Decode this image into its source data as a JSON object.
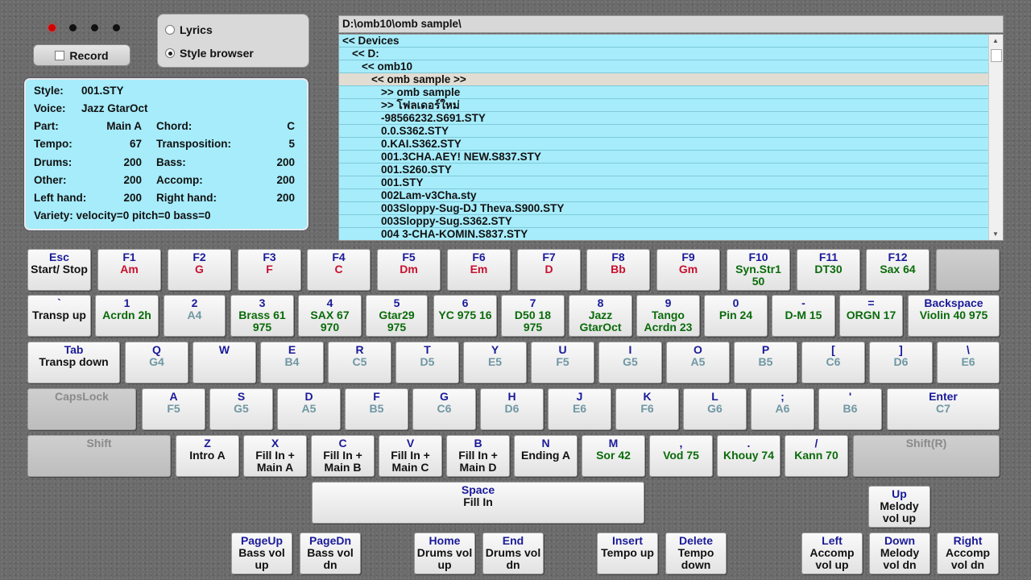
{
  "leds": [
    true,
    false,
    false,
    false
  ],
  "record": {
    "label": "Record"
  },
  "mode": {
    "lyrics": "Lyrics",
    "style_browser": "Style browser",
    "selected": "style_browser"
  },
  "info": {
    "style_label": "Style:",
    "style_value": "001.STY",
    "voice_label": "Voice:",
    "voice_value": "Jazz GtarOct",
    "part_label": "Part:",
    "part_value": "Main A",
    "chord_label": "Chord:",
    "chord_value": "C",
    "tempo_label": "Tempo:",
    "tempo_value": "67",
    "transposition_label": "Transposition:",
    "transposition_value": "5",
    "drums_label": "Drums:",
    "drums_value": "200",
    "bass_label": "Bass:",
    "bass_value": "200",
    "other_label": "Other:",
    "other_value": "200",
    "accomp_label": "Accomp:",
    "accomp_value": "200",
    "lefthand_label": "Left hand:",
    "lefthand_value": "200",
    "righthand_label": "Right hand:",
    "righthand_value": "200",
    "variety": "Variety: velocity=0 pitch=0 bass=0"
  },
  "browser": {
    "path": "D:\\omb10\\omb sample\\",
    "items": [
      "<< Devices",
      "<< D:",
      "<< omb10",
      "<< omb sample >>",
      ">> omb sample",
      ">> โฟลเดอร์ใหม่",
      "-98566232.S691.STY",
      "0.0.S362.STY",
      "0.KAI.S362.STY",
      "001.3CHA.AEY! NEW.S837.STY",
      "001.S260.STY",
      "001.STY",
      "002Lam-v3Cha.sty",
      "003Sloppy-Sug-DJ Theva.S900.STY",
      "003Sloppy-Sug.S362.STY",
      "004 3-CHA-KOMIN.S837.STY"
    ],
    "selected_index": 3
  },
  "keyboard": {
    "row1": [
      {
        "k": "Esc",
        "t": "Start/ Stop",
        "c": "black"
      },
      {
        "k": "F1",
        "t": "Am",
        "c": "red"
      },
      {
        "k": "F2",
        "t": "G",
        "c": "red"
      },
      {
        "k": "F3",
        "t": "F",
        "c": "red"
      },
      {
        "k": "F4",
        "t": "C",
        "c": "red"
      },
      {
        "k": "F5",
        "t": "Dm",
        "c": "red"
      },
      {
        "k": "F6",
        "t": "Em",
        "c": "red"
      },
      {
        "k": "F7",
        "t": "D",
        "c": "red"
      },
      {
        "k": "F8",
        "t": "Bb",
        "c": "red"
      },
      {
        "k": "F9",
        "t": "Gm",
        "c": "red"
      },
      {
        "k": "F10",
        "t": "Syn.Str1\n50",
        "c": "green"
      },
      {
        "k": "F11",
        "t": "DT30",
        "c": "green"
      },
      {
        "k": "F12",
        "t": "Sax 64",
        "c": "green"
      },
      {
        "k": "",
        "t": "",
        "c": "black",
        "dis": true
      }
    ],
    "row2": [
      {
        "k": "`",
        "t": "Transp up",
        "c": "black"
      },
      {
        "k": "1",
        "t": "Acrdn 2h",
        "c": "green"
      },
      {
        "k": "2",
        "t": "A4",
        "c": "teal"
      },
      {
        "k": "3",
        "t": "Brass 61\n975",
        "c": "green"
      },
      {
        "k": "4",
        "t": "SAX 67\n970",
        "c": "green"
      },
      {
        "k": "5",
        "t": "Gtar29\n975",
        "c": "green"
      },
      {
        "k": "6",
        "t": "YC 975 16",
        "c": "green"
      },
      {
        "k": "7",
        "t": "D50 18\n975",
        "c": "green"
      },
      {
        "k": "8",
        "t": "Jazz\nGtarOct",
        "c": "green"
      },
      {
        "k": "9",
        "t": "Tango\nAcrdn 23",
        "c": "green"
      },
      {
        "k": "0",
        "t": "Pin 24",
        "c": "green"
      },
      {
        "k": "-",
        "t": "D-M 15",
        "c": "green"
      },
      {
        "k": "=",
        "t": "ORGN 17",
        "c": "green"
      },
      {
        "k": "Backspace",
        "t": "Violin 40 975",
        "c": "green"
      }
    ],
    "row3": [
      {
        "k": "Tab",
        "t": "Transp down",
        "c": "black"
      },
      {
        "k": "Q",
        "t": "G4",
        "c": "teal"
      },
      {
        "k": "W",
        "t": "",
        "c": "teal"
      },
      {
        "k": "E",
        "t": "B4",
        "c": "teal"
      },
      {
        "k": "R",
        "t": "C5",
        "c": "teal"
      },
      {
        "k": "T",
        "t": "D5",
        "c": "teal"
      },
      {
        "k": "Y",
        "t": "E5",
        "c": "teal"
      },
      {
        "k": "U",
        "t": "F5",
        "c": "teal"
      },
      {
        "k": "I",
        "t": "G5",
        "c": "teal"
      },
      {
        "k": "O",
        "t": "A5",
        "c": "teal"
      },
      {
        "k": "P",
        "t": "B5",
        "c": "teal"
      },
      {
        "k": "[",
        "t": "C6",
        "c": "teal"
      },
      {
        "k": "]",
        "t": "D6",
        "c": "teal"
      },
      {
        "k": "\\",
        "t": "E6",
        "c": "teal"
      }
    ],
    "row4": [
      {
        "k": "CapsLock",
        "t": "",
        "c": "black",
        "dis": true
      },
      {
        "k": "A",
        "t": "F5",
        "c": "teal"
      },
      {
        "k": "S",
        "t": "G5",
        "c": "teal"
      },
      {
        "k": "D",
        "t": "A5",
        "c": "teal"
      },
      {
        "k": "F",
        "t": "B5",
        "c": "teal"
      },
      {
        "k": "G",
        "t": "C6",
        "c": "teal"
      },
      {
        "k": "H",
        "t": "D6",
        "c": "teal"
      },
      {
        "k": "J",
        "t": "E6",
        "c": "teal"
      },
      {
        "k": "K",
        "t": "F6",
        "c": "teal"
      },
      {
        "k": "L",
        "t": "G6",
        "c": "teal"
      },
      {
        "k": ";",
        "t": "A6",
        "c": "teal"
      },
      {
        "k": "'",
        "t": "B6",
        "c": "teal"
      },
      {
        "k": "Enter",
        "t": "C7",
        "c": "teal"
      }
    ],
    "row5": [
      {
        "k": "Shift",
        "t": "",
        "c": "black",
        "dis": true
      },
      {
        "k": "Z",
        "t": "Intro A",
        "c": "black"
      },
      {
        "k": "X",
        "t": "Fill In +\nMain A",
        "c": "black"
      },
      {
        "k": "C",
        "t": "Fill In +\nMain B",
        "c": "black"
      },
      {
        "k": "V",
        "t": "Fill In +\nMain C",
        "c": "black"
      },
      {
        "k": "B",
        "t": "Fill In +\nMain D",
        "c": "black"
      },
      {
        "k": "N",
        "t": "Ending A",
        "c": "black"
      },
      {
        "k": "M",
        "t": "Sor 42",
        "c": "green"
      },
      {
        "k": ",",
        "t": "Vod 75",
        "c": "green"
      },
      {
        "k": ".",
        "t": "Khouy 74",
        "c": "green"
      },
      {
        "k": "/",
        "t": "Kann 70",
        "c": "green"
      },
      {
        "k": "Shift(R)",
        "t": "",
        "c": "black",
        "dis": true
      }
    ],
    "space": {
      "k": "Space",
      "t": "Fill In",
      "c": "black"
    },
    "up": {
      "k": "Up",
      "t": "Melody\nvol up",
      "c": "black"
    },
    "row7": [
      {
        "k": "PageUp",
        "t": "Bass vol\nup",
        "c": "black"
      },
      {
        "k": "PageDn",
        "t": "Bass vol\ndn",
        "c": "black"
      },
      {
        "k": "Home",
        "t": "Drums vol\nup",
        "c": "black"
      },
      {
        "k": "End",
        "t": "Drums vol\ndn",
        "c": "black"
      },
      {
        "k": "Insert",
        "t": "Tempo up",
        "c": "black"
      },
      {
        "k": "Delete",
        "t": "Tempo\ndown",
        "c": "black"
      },
      {
        "k": "Left",
        "t": "Accomp\nvol up",
        "c": "black"
      },
      {
        "k": "Down",
        "t": "Melody\nvol dn",
        "c": "black"
      },
      {
        "k": "Right",
        "t": "Accomp\nvol dn",
        "c": "black"
      }
    ]
  }
}
